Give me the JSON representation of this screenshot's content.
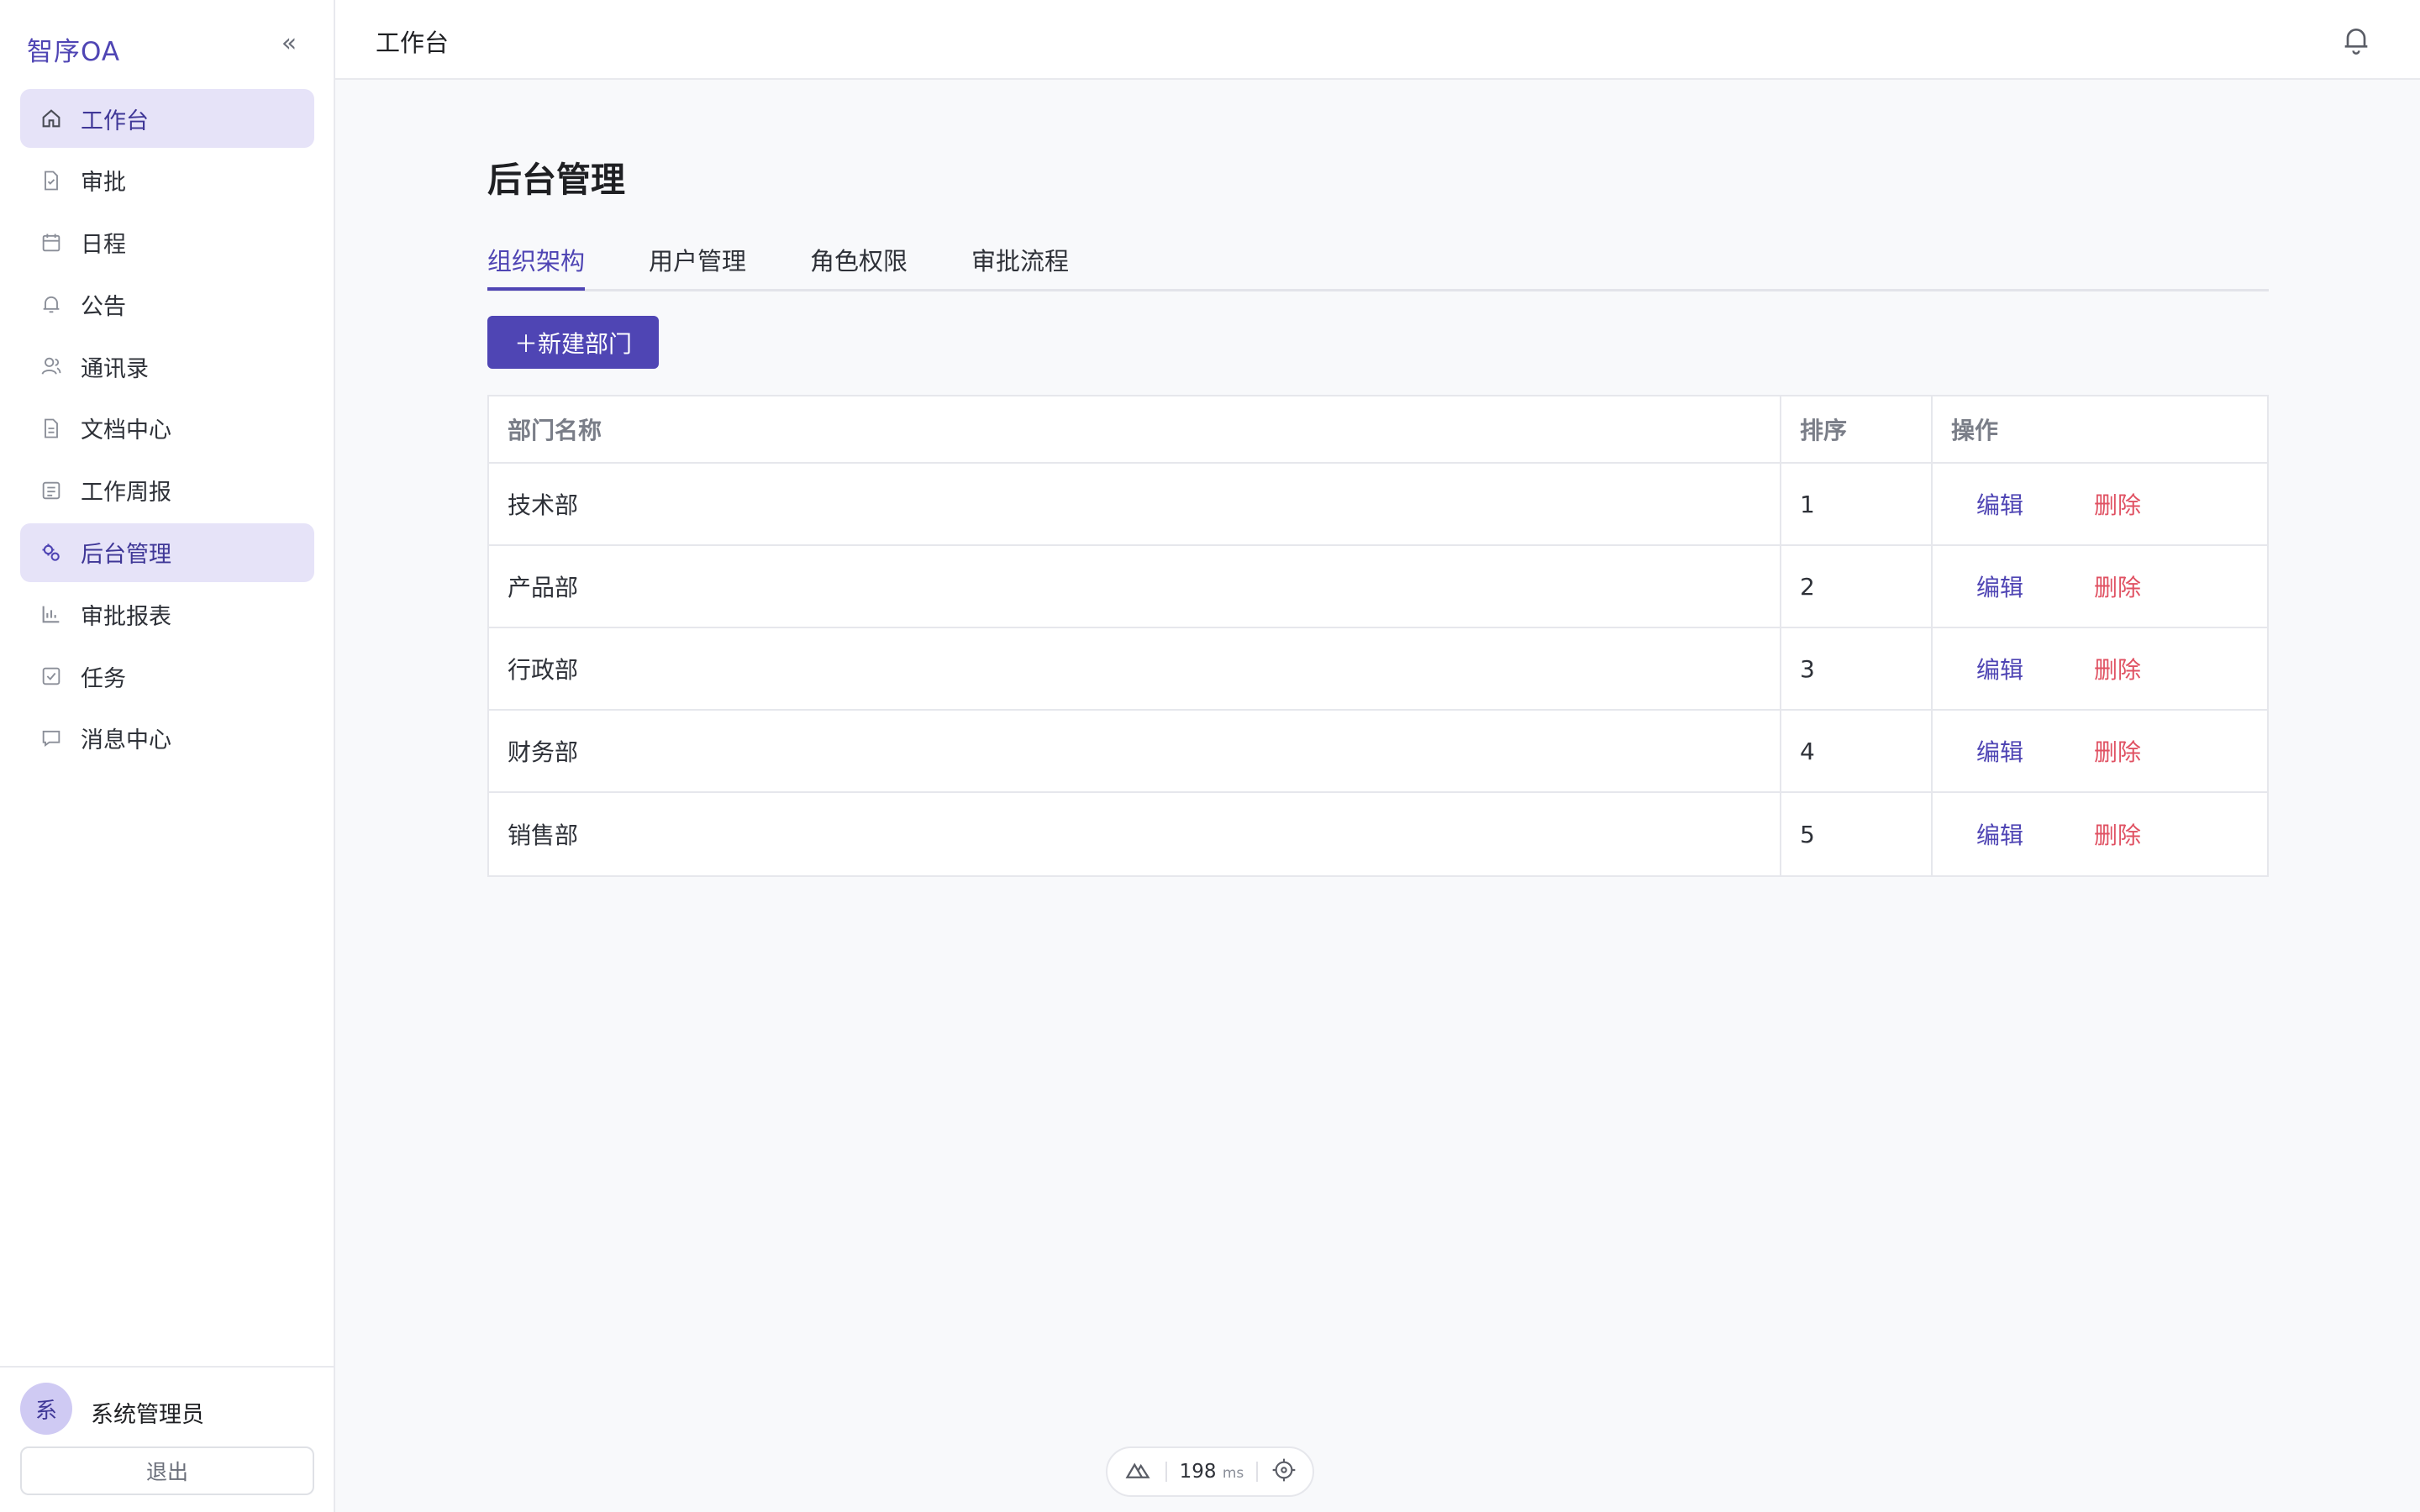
{
  "app": {
    "brand": "智序OA",
    "collapse_glyph": "«"
  },
  "sidebar": {
    "items": [
      {
        "label": "工作台",
        "icon": "home-icon",
        "active": true
      },
      {
        "label": "审批",
        "icon": "approval-doc-icon",
        "active": false
      },
      {
        "label": "日程",
        "icon": "calendar-icon",
        "active": false
      },
      {
        "label": "公告",
        "icon": "bell-icon",
        "active": false
      },
      {
        "label": "通讯录",
        "icon": "contacts-icon",
        "active": false
      },
      {
        "label": "文档中心",
        "icon": "document-icon",
        "active": false
      },
      {
        "label": "工作周报",
        "icon": "report-list-icon",
        "active": false
      },
      {
        "label": "后台管理",
        "icon": "admin-settings-icon",
        "active": true
      },
      {
        "label": "审批报表",
        "icon": "bar-chart-icon",
        "active": false
      },
      {
        "label": "任务",
        "icon": "task-check-icon",
        "active": false
      },
      {
        "label": "消息中心",
        "icon": "message-icon",
        "active": false
      }
    ],
    "user": {
      "avatar_text": "系",
      "name": "系统管理员"
    },
    "logout_label": "退出"
  },
  "header": {
    "title": "工作台",
    "bell_icon": "notification-bell-icon"
  },
  "main": {
    "page_title": "后台管理",
    "tabs": [
      {
        "label": "组织架构",
        "active": true
      },
      {
        "label": "用户管理",
        "active": false
      },
      {
        "label": "角色权限",
        "active": false
      },
      {
        "label": "审批流程",
        "active": false
      }
    ],
    "new_button_label": "＋新建部门",
    "table": {
      "headers": [
        "部门名称",
        "排序",
        "操作"
      ],
      "rows": [
        {
          "name": "技术部",
          "order": "1",
          "edit": "编辑",
          "delete": "删除"
        },
        {
          "name": "产品部",
          "order": "2",
          "edit": "编辑",
          "delete": "删除"
        },
        {
          "name": "行政部",
          "order": "3",
          "edit": "编辑",
          "delete": "删除"
        },
        {
          "name": "财务部",
          "order": "4",
          "edit": "编辑",
          "delete": "删除"
        },
        {
          "name": "销售部",
          "order": "5",
          "edit": "编辑",
          "delete": "删除"
        }
      ]
    }
  },
  "devtools": {
    "timing_value": "198",
    "timing_unit": "ms"
  },
  "colors": {
    "accent": "#4f45b4",
    "active_bg": "#e6e3f8",
    "danger": "#e05263"
  }
}
